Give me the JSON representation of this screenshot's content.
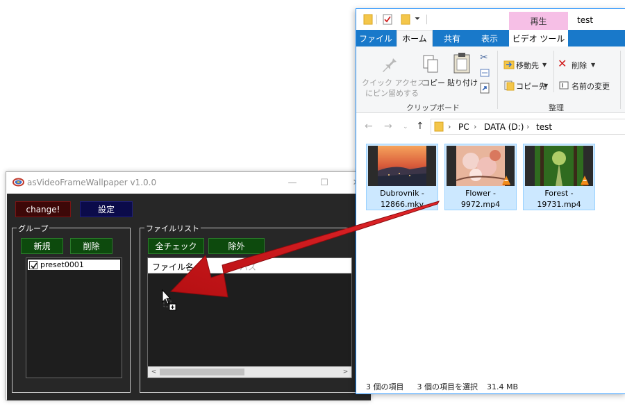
{
  "app": {
    "title": "asVideoFrameWallpaper v1.0.0",
    "buttons": {
      "change": "change!",
      "settings": "設定"
    },
    "group": {
      "label": "グループ",
      "new_button": "新規",
      "delete_button": "削除",
      "presets": [
        {
          "label": "preset0001",
          "checked": true
        }
      ]
    },
    "filelist": {
      "label": "ファイルリスト",
      "check_all_button": "全チェック",
      "exclude_button": "除外",
      "columns": [
        "ファイル名",
        "パス"
      ]
    }
  },
  "explorer": {
    "window_title": "test",
    "context_tab": "再生",
    "tabs": [
      "ファイル",
      "ホーム",
      "共有",
      "表示",
      "ビデオ ツール"
    ],
    "active_tab": "ホーム",
    "ribbon": {
      "pin_label_line1": "クイック アクセス",
      "pin_label_line2": "にピン留めする",
      "copy": "コピー",
      "paste": "貼り付け",
      "clipboard_group": "クリップボード",
      "move_to": "移動先",
      "copy_to": "コピー先",
      "delete": "削除",
      "rename": "名前の変更",
      "organize_group": "整理"
    },
    "breadcrumb": [
      "PC",
      "DATA (D:)",
      "test"
    ],
    "files": [
      {
        "name_line1": "Dubrovnik -",
        "name_line2": "12866.mkv",
        "vlc": false
      },
      {
        "name_line1": "Flower -",
        "name_line2": "9972.mp4",
        "vlc": true
      },
      {
        "name_line1": "Forest -",
        "name_line2": "19731.mp4",
        "vlc": true
      }
    ],
    "status": {
      "item_count": "3 個の項目",
      "selection": "3 個の項目を選択",
      "size": "31.4 MB"
    }
  },
  "colors": {
    "app_bg": "#272727",
    "change_button_bg": "#3d0808",
    "settings_button_bg": "#0b0b4a",
    "green_button_bg": "#0d4a0d",
    "ribbon_blue": "#1979ca",
    "context_tab_pink": "#f6bfe6",
    "selection_blue": "#cce8ff",
    "arrow_red": "#d0181c"
  }
}
